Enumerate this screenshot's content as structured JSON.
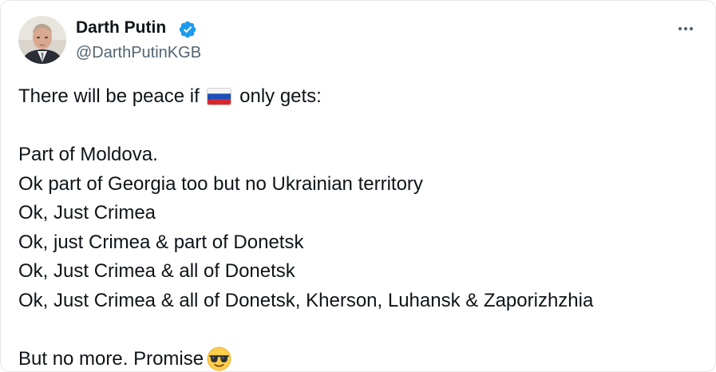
{
  "author": {
    "name": "Darth Putin",
    "handle": "@DarthPutinKGB",
    "verified": true,
    "avatar_icon": "profile-photo"
  },
  "menu": {
    "icon": "more-horizontal-icon"
  },
  "tweet": {
    "line1_before_flag": "There will be peace if",
    "flag_icon": "russia-flag-emoji",
    "line1_after_flag": "only gets:",
    "lines": [
      "Part of Moldova.",
      "Ok part of Georgia too but no Ukrainian territory",
      "Ok, Just Crimea",
      "Ok, just Crimea & part of Donetsk",
      "Ok, Just Crimea & all of Donetsk",
      "Ok, Just Crimea & all of Donetsk, Kherson, Luhansk & Zaporizhzhia"
    ],
    "closing": "But no more. Promise",
    "closing_emoji": "smiling-face-with-sunglasses-emoji"
  },
  "colors": {
    "text": "#0f1419",
    "secondary": "#536471",
    "verified_blue": "#1d9bf0"
  }
}
